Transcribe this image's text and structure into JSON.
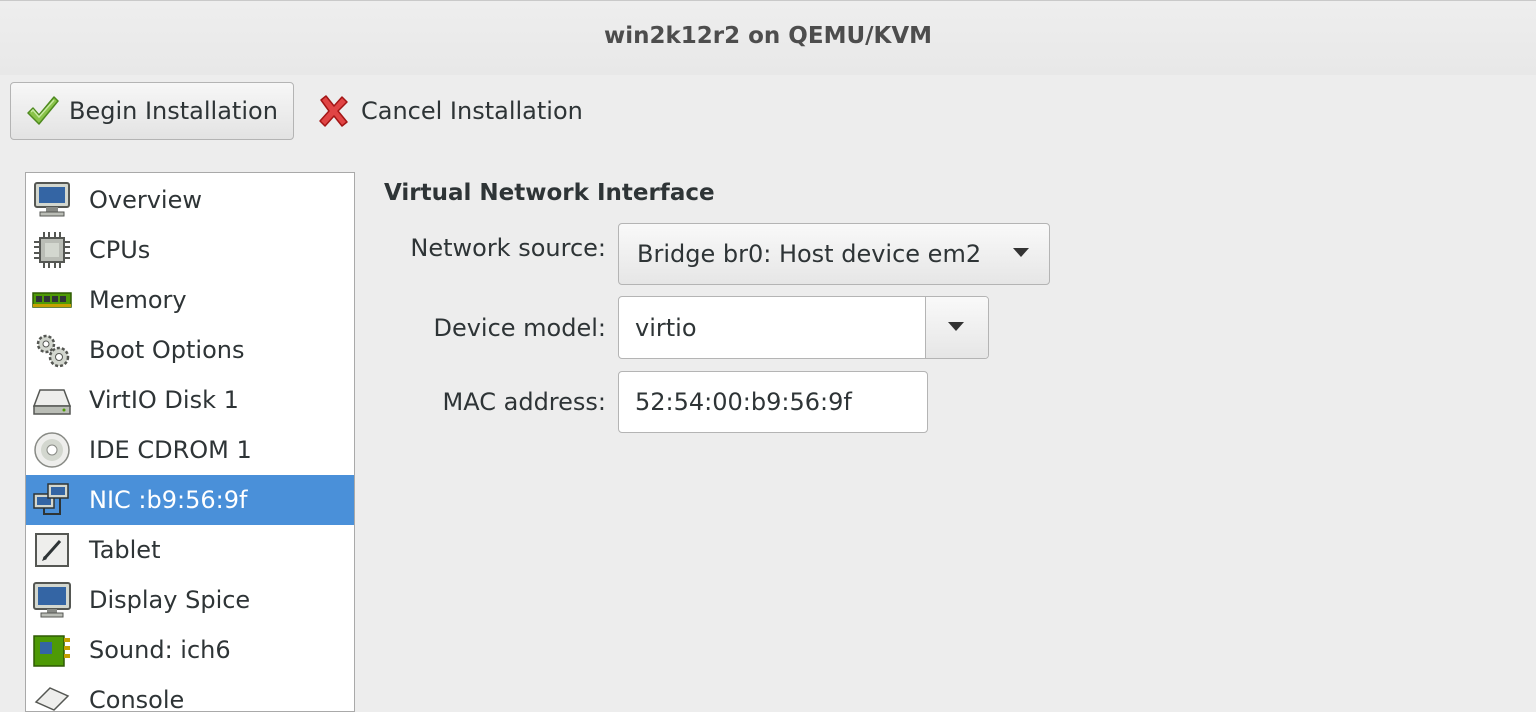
{
  "window": {
    "title": "win2k12r2 on QEMU/KVM"
  },
  "toolbar": {
    "begin_label": "Begin Installation",
    "cancel_label": "Cancel Installation"
  },
  "sidebar": {
    "items": [
      {
        "label": "Overview",
        "icon": "monitor-icon"
      },
      {
        "label": "CPUs",
        "icon": "cpu-icon"
      },
      {
        "label": "Memory",
        "icon": "memory-icon"
      },
      {
        "label": "Boot Options",
        "icon": "gears-icon"
      },
      {
        "label": "VirtIO Disk 1",
        "icon": "disk-icon"
      },
      {
        "label": "IDE CDROM 1",
        "icon": "cdrom-icon"
      },
      {
        "label": "NIC :b9:56:9f",
        "icon": "network-icon",
        "selected": true
      },
      {
        "label": "Tablet",
        "icon": "tablet-icon"
      },
      {
        "label": "Display Spice",
        "icon": "display-icon"
      },
      {
        "label": "Sound: ich6",
        "icon": "sound-icon"
      },
      {
        "label": "Console",
        "icon": "console-icon"
      }
    ]
  },
  "details": {
    "section_title": "Virtual Network Interface",
    "network_source": {
      "label": "Network source:",
      "value": "Bridge br0: Host device em2"
    },
    "device_model": {
      "label": "Device model:",
      "value": "virtio"
    },
    "mac_address": {
      "label": "MAC address:",
      "value": "52:54:00:b9:56:9f"
    }
  },
  "colors": {
    "selection": "#4a90d9",
    "background": "#ededed"
  }
}
